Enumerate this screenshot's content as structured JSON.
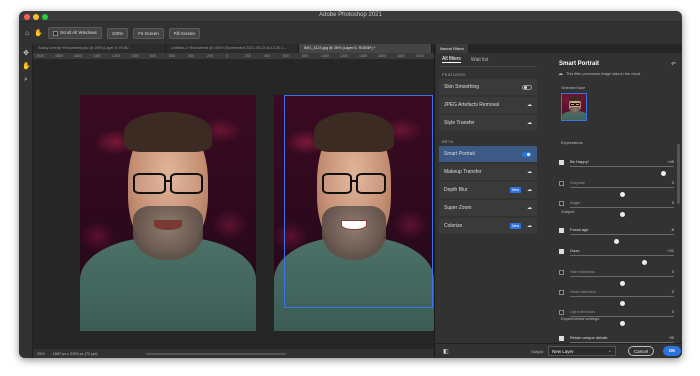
{
  "app": {
    "title": "Adobe Photoshop 2021"
  },
  "options": {
    "scroll_all": "Scroll All Windows",
    "zoom": "100%",
    "fit": "Fit Screen",
    "fill": "Fill Screen"
  },
  "doc_tabs": [
    "Sassy Liberty~Recovered.psd @ 25% (Layer 0, RGB/...",
    "Untitled-1~Recovered @ 100% (Screenshot 2021-09-23 at 13.30.1...",
    "IMG_3124.jpg @ 25% (Layer 0, RGB/8*) *"
  ],
  "ruler_ticks": [
    "2000",
    "1800",
    "1600",
    "1400",
    "1200",
    "1000",
    "800",
    "600",
    "400",
    "200",
    "0",
    "200",
    "400",
    "600",
    "800",
    "1000",
    "1200",
    "1400",
    "1600",
    "1800",
    "2000"
  ],
  "status": {
    "zoom": "25%",
    "size": "1687 px x 2300 px (72 ppi)"
  },
  "panel": {
    "tab": "Neural Filters",
    "tabs": [
      "All filters",
      "Wait list"
    ],
    "featured_label": "FEATURED",
    "beta_label": "BETA",
    "featured": [
      {
        "label": "Skin Smoothing",
        "toggle": "off"
      },
      {
        "label": "JPEG Artefacts Removal",
        "toggle": "cloud"
      },
      {
        "label": "Style Transfer",
        "toggle": "cloud"
      }
    ],
    "beta": [
      {
        "label": "Smart Portrait",
        "toggle": "on",
        "selected": true
      },
      {
        "label": "Makeup Transfer",
        "toggle": "cloud"
      },
      {
        "label": "Depth Blur",
        "toggle": "cloud",
        "badge": "New"
      },
      {
        "label": "Super Zoom",
        "toggle": "cloud"
      },
      {
        "label": "Colorize",
        "toggle": "cloud",
        "badge": "New"
      }
    ],
    "right": {
      "title": "Smart Portrait",
      "desc": "This filter processes image data in the cloud.",
      "selected_face": "Selected face",
      "expressions": "Expressions",
      "subject": "Subject",
      "experimental": "Experimental settings",
      "sliders": [
        {
          "label": "Be Happy!",
          "checked": true,
          "value": "+45",
          "pos": 0.9
        },
        {
          "label": "Surprise",
          "checked": false,
          "value": "0",
          "pos": 0.5
        },
        {
          "label": "Anger",
          "checked": false,
          "value": "0",
          "pos": 0.5
        },
        {
          "label": "Facial age",
          "checked": true,
          "value": "-8",
          "pos": 0.45
        },
        {
          "label": "Gaze",
          "checked": true,
          "value": "+31",
          "pos": 0.72
        },
        {
          "label": "Hair thickness",
          "checked": false,
          "value": "0",
          "pos": 0.5
        },
        {
          "label": "Head direction",
          "checked": false,
          "value": "0",
          "pos": 0.5
        },
        {
          "label": "Light direction",
          "checked": false,
          "value": "0",
          "pos": 0.5
        },
        {
          "label": "Retain unique details",
          "checked": true,
          "value": "90",
          "pos": 0.9
        }
      ]
    },
    "footer": {
      "output_label": "Output",
      "output_value": "New Layer",
      "cancel": "Cancel",
      "ok": "OK"
    }
  }
}
